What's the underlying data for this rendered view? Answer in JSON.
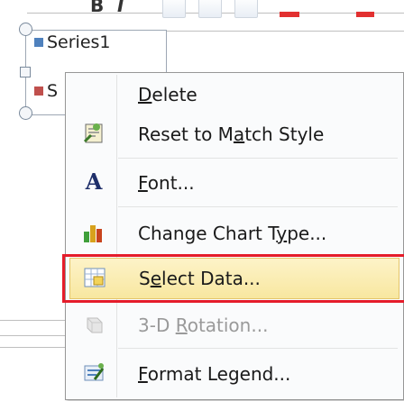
{
  "legend": {
    "series": [
      {
        "label": "Series1",
        "color": "#4f81bd"
      },
      {
        "label": "S",
        "color": "#c0504d"
      }
    ]
  },
  "menu": {
    "items": [
      {
        "pre": "",
        "u": "D",
        "post": "elete",
        "icon": "delete-blank",
        "disabled": false
      },
      {
        "pre": "Reset to M",
        "u": "a",
        "post": "tch Style",
        "icon": "reset-style-icon",
        "disabled": false
      },
      {
        "pre": "",
        "u": "F",
        "post": "ont...",
        "icon": "font-icon",
        "disabled": false
      },
      {
        "pre": "Change Chart T",
        "u": "y",
        "post": "pe...",
        "icon": "chart-type-icon",
        "disabled": false
      },
      {
        "pre": "S",
        "u": "e",
        "post": "lect Data...",
        "icon": "select-data-icon",
        "disabled": false,
        "highlighted": true
      },
      {
        "pre": "3-D ",
        "u": "R",
        "post": "otation...",
        "icon": "rotation-3d-icon",
        "disabled": true
      },
      {
        "pre": "",
        "u": "F",
        "post": "ormat Legend...",
        "icon": "format-legend-icon",
        "disabled": false
      }
    ],
    "font_icon_glyph": "A"
  },
  "colors": {
    "highlight_border": "#e51c2a",
    "hover_fill": "#f8e7a0"
  }
}
